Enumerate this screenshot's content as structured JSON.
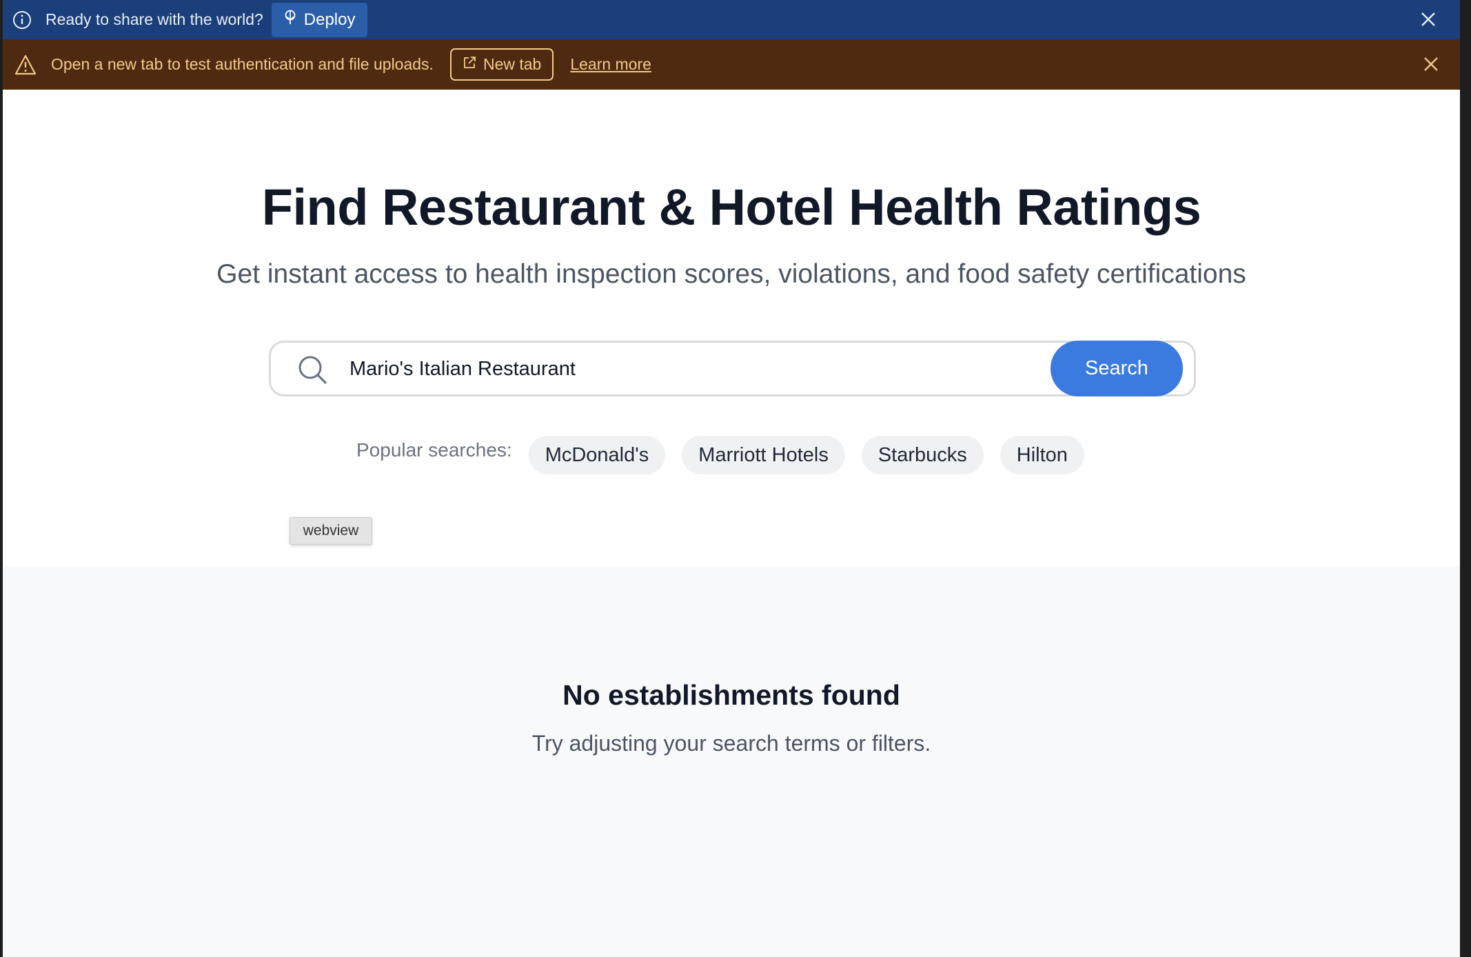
{
  "deploy_bar": {
    "message": "Ready to share with the world?",
    "deploy_label": "Deploy",
    "background": "#1a3f7a"
  },
  "warning_bar": {
    "message": "Open a new tab to test authentication and file uploads.",
    "new_tab_label": "New tab",
    "learn_more_label": "Learn more",
    "background": "#4e2a10"
  },
  "hero": {
    "title": "Find Restaurant & Hotel Health Ratings",
    "subtitle": "Get instant access to health inspection scores, violations, and food safety certifications"
  },
  "search": {
    "value": "Mario's Italian Restaurant",
    "button_label": "Search",
    "accent": "#3b7be0"
  },
  "popular": {
    "label": "Popular searches:",
    "items": [
      "McDonald's",
      "Marriott Hotels",
      "Starbucks",
      "Hilton"
    ]
  },
  "webview_tag": "webview",
  "empty_state": {
    "title": "No establishments found",
    "message": "Try adjusting your search terms or filters."
  }
}
